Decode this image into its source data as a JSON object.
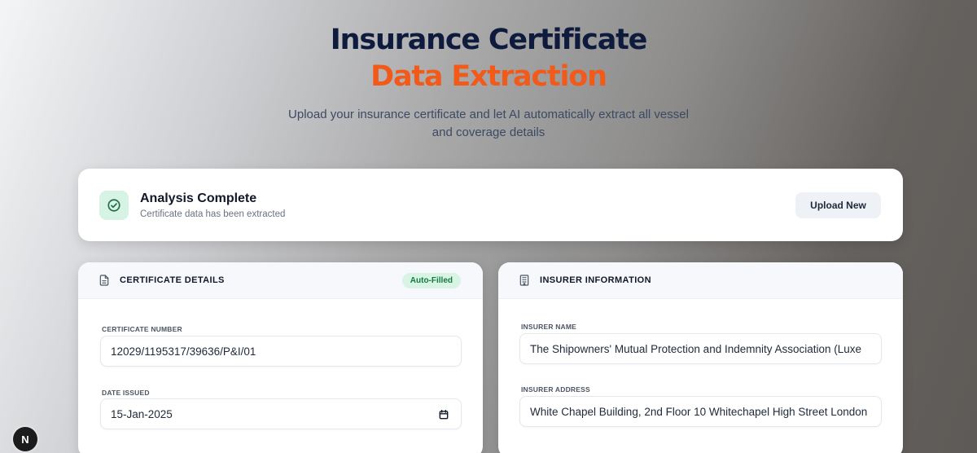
{
  "hero": {
    "title_line1": "Insurance Certificate",
    "title_line2": "Data Extraction",
    "subtitle": "Upload your insurance certificate and let AI automatically extract all vessel and coverage details"
  },
  "status": {
    "icon": "check-circle-icon",
    "title": "Analysis Complete",
    "subtitle": "Certificate data has been extracted",
    "upload_button": "Upload New"
  },
  "certificate_details": {
    "icon": "document-icon",
    "title": "CERTIFICATE DETAILS",
    "badge": "Auto-Filled",
    "certificate_number_label": "CERTIFICATE NUMBER",
    "certificate_number_value": "12029/1195317/39636/P&I/01",
    "date_issued_label": "DATE ISSUED",
    "date_issued_value": "15-Jan-2025"
  },
  "insurer_information": {
    "icon": "building-icon",
    "title": "INSURER INFORMATION",
    "insurer_name_label": "INSURER NAME",
    "insurer_name_value": "The Shipowners' Mutual Protection and Indemnity Association (Luxe",
    "insurer_address_label": "INSURER ADDRESS",
    "insurer_address_value": "White Chapel Building, 2nd Floor 10 Whitechapel High Street London"
  },
  "dev_badge": {
    "label": "N"
  },
  "colors": {
    "title_dark": "#0f1b3d",
    "title_accent": "#f25a1a",
    "success_bg": "#d7f3e3",
    "success_fg": "#137a44"
  }
}
